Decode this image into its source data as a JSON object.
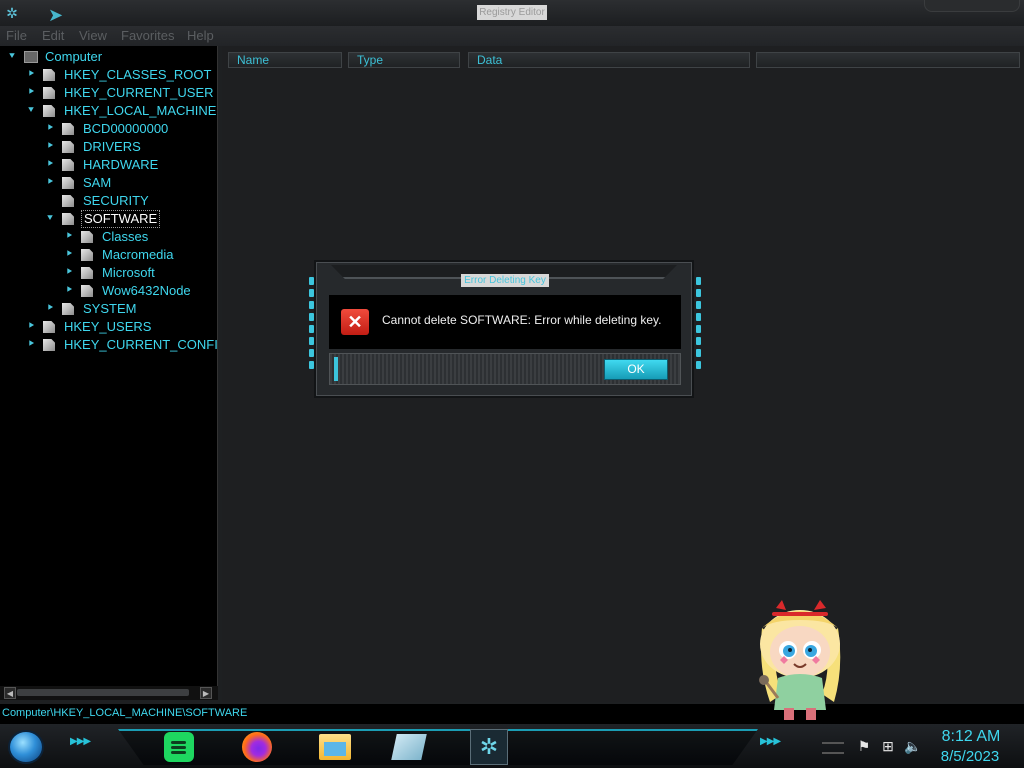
{
  "window": {
    "title": "Registry Editor",
    "menu": [
      "File",
      "Edit",
      "View",
      "Favorites",
      "Help"
    ]
  },
  "tree": {
    "root": "Computer",
    "items": [
      {
        "label": "HKEY_CLASSES_ROOT",
        "depth": 1,
        "state": "collapsed"
      },
      {
        "label": "HKEY_CURRENT_USER",
        "depth": 1,
        "state": "collapsed"
      },
      {
        "label": "HKEY_LOCAL_MACHINE",
        "depth": 1,
        "state": "expanded"
      },
      {
        "label": "BCD00000000",
        "depth": 2,
        "state": "collapsed"
      },
      {
        "label": "DRIVERS",
        "depth": 2,
        "state": "collapsed"
      },
      {
        "label": "HARDWARE",
        "depth": 2,
        "state": "collapsed"
      },
      {
        "label": "SAM",
        "depth": 2,
        "state": "collapsed"
      },
      {
        "label": "SECURITY",
        "depth": 2,
        "state": "none"
      },
      {
        "label": "SOFTWARE",
        "depth": 2,
        "state": "expanded",
        "selected": true
      },
      {
        "label": "Classes",
        "depth": 3,
        "state": "collapsed"
      },
      {
        "label": "Macromedia",
        "depth": 3,
        "state": "collapsed"
      },
      {
        "label": "Microsoft",
        "depth": 3,
        "state": "collapsed"
      },
      {
        "label": "Wow6432Node",
        "depth": 3,
        "state": "collapsed"
      },
      {
        "label": "SYSTEM",
        "depth": 2,
        "state": "collapsed"
      },
      {
        "label": "HKEY_USERS",
        "depth": 1,
        "state": "collapsed"
      },
      {
        "label": "HKEY_CURRENT_CONFI",
        "depth": 1,
        "state": "collapsed"
      }
    ]
  },
  "list": {
    "columns": [
      "Name",
      "Type",
      "Data",
      ""
    ]
  },
  "status": {
    "path": "Computer\\HKEY_LOCAL_MACHINE\\SOFTWARE"
  },
  "dialog": {
    "title": "Error Deleting Key",
    "message": "Cannot delete SOFTWARE:  Error while deleting key.",
    "ok_label": "OK",
    "icon": "error-x-icon"
  },
  "taskbar": {
    "apps": [
      "spotify-icon",
      "firefox-icon",
      "file-explorer-icon",
      "registry-editor-icon",
      "regedit-active-icon"
    ],
    "time": "8:12 AM",
    "date": "8/5/2023"
  },
  "colors": {
    "accent": "#3fd7ee",
    "tree_bg": "#000000",
    "window_bg": "#1e2022",
    "error_red": "#d9291c"
  }
}
